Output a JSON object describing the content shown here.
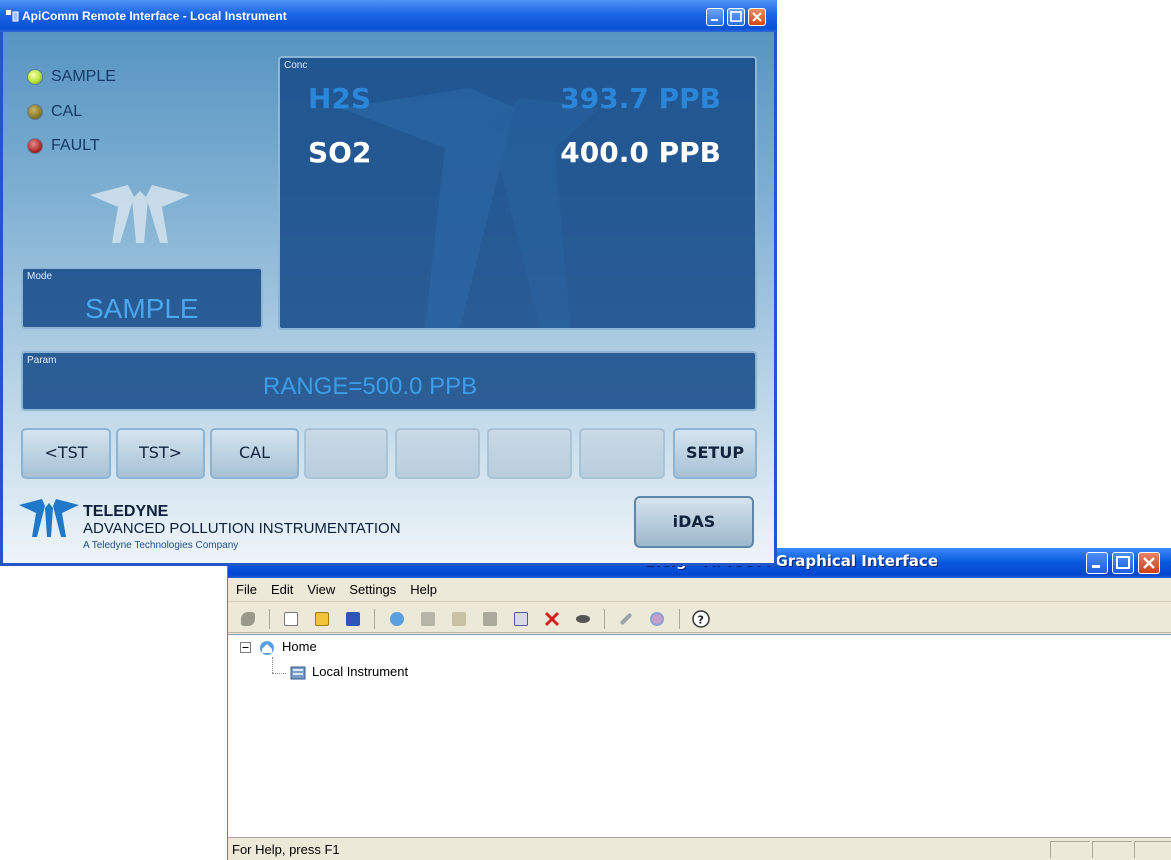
{
  "colors": {
    "accent": "#0a5ae0",
    "conc_h2s": "#2a86d8",
    "conc_so2": "#ffffff",
    "param_text": "#3a9de8",
    "mode_text": "#4aa6ee"
  },
  "back_window": {
    "title": "2.cfg - APICOM Graphical Interface",
    "menu": [
      "File",
      "Edit",
      "View",
      "Settings",
      "Help"
    ],
    "toolbar_icons": [
      "connect-icon",
      "new-icon",
      "open-icon",
      "save-icon",
      "network-icon",
      "remove-icon",
      "users-icon",
      "copy-icon",
      "properties-icon",
      "delete-icon",
      "disconnect-icon",
      "tools-icon",
      "options-icon",
      "help-icon"
    ],
    "tree": {
      "root": "Home",
      "child": "Local Instrument"
    },
    "status": "For Help, press F1"
  },
  "front_window": {
    "title": "ApiComm Remote Interface - Local Instrument",
    "leds": [
      {
        "label": "SAMPLE",
        "color": "#b8e63a"
      },
      {
        "label": "CAL",
        "color": "#8a7a2a"
      },
      {
        "label": "FAULT",
        "color": "#b02a2a"
      }
    ],
    "conc": {
      "label": "Conc",
      "rows": [
        {
          "name": "H2S",
          "value": "393.7 PPB"
        },
        {
          "name": "SO2",
          "value": "400.0 PPB"
        }
      ]
    },
    "mode": {
      "label": "Mode",
      "value": "SAMPLE"
    },
    "param": {
      "label": "Param",
      "value": "RANGE=500.0 PPB"
    },
    "buttons": [
      "<TST",
      "TST>",
      "CAL",
      "",
      "",
      "",
      "",
      "SETUP"
    ],
    "idas": "iDAS",
    "brand": {
      "name": "TELEDYNE",
      "division": "ADVANCED POLLUTION INSTRUMENTATION",
      "tagline": "A Teledyne Technologies Company"
    }
  }
}
